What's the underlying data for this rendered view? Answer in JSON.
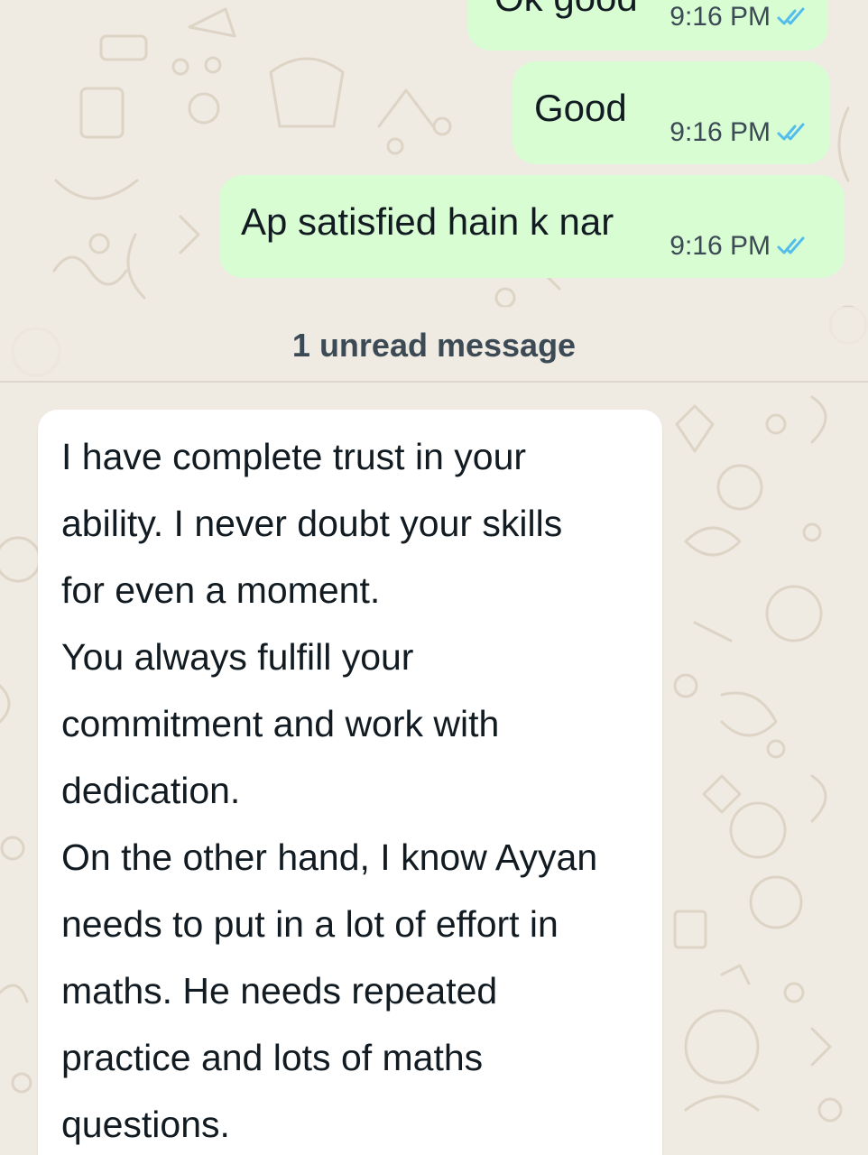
{
  "accent_colors": {
    "outgoing_bubble": "#d9fdd3",
    "incoming_bubble": "#ffffff",
    "read_ticks": "#53bdeb",
    "background": "#efeae2"
  },
  "messages_outgoing": [
    {
      "text": "Ok good",
      "time": "9:16 PM",
      "status_icon": "double-check-read-icon"
    },
    {
      "text": "Good",
      "time": "9:16 PM",
      "status_icon": "double-check-read-icon"
    },
    {
      "text": "Ap satisfied hain k nar",
      "time": "9:16 PM",
      "status_icon": "double-check-read-icon"
    }
  ],
  "unread_divider": "1 unread message",
  "message_incoming": {
    "lines": [
      "I have complete trust in your",
      "ability. I never doubt your skills",
      "for even a moment.",
      "You always fulfill your",
      "commitment and work with",
      "dedication.",
      "On the other hand, I know Ayyan",
      "needs to put in a lot of effort in",
      "maths. He needs repeated",
      "practice and lots of maths",
      "questions."
    ]
  }
}
